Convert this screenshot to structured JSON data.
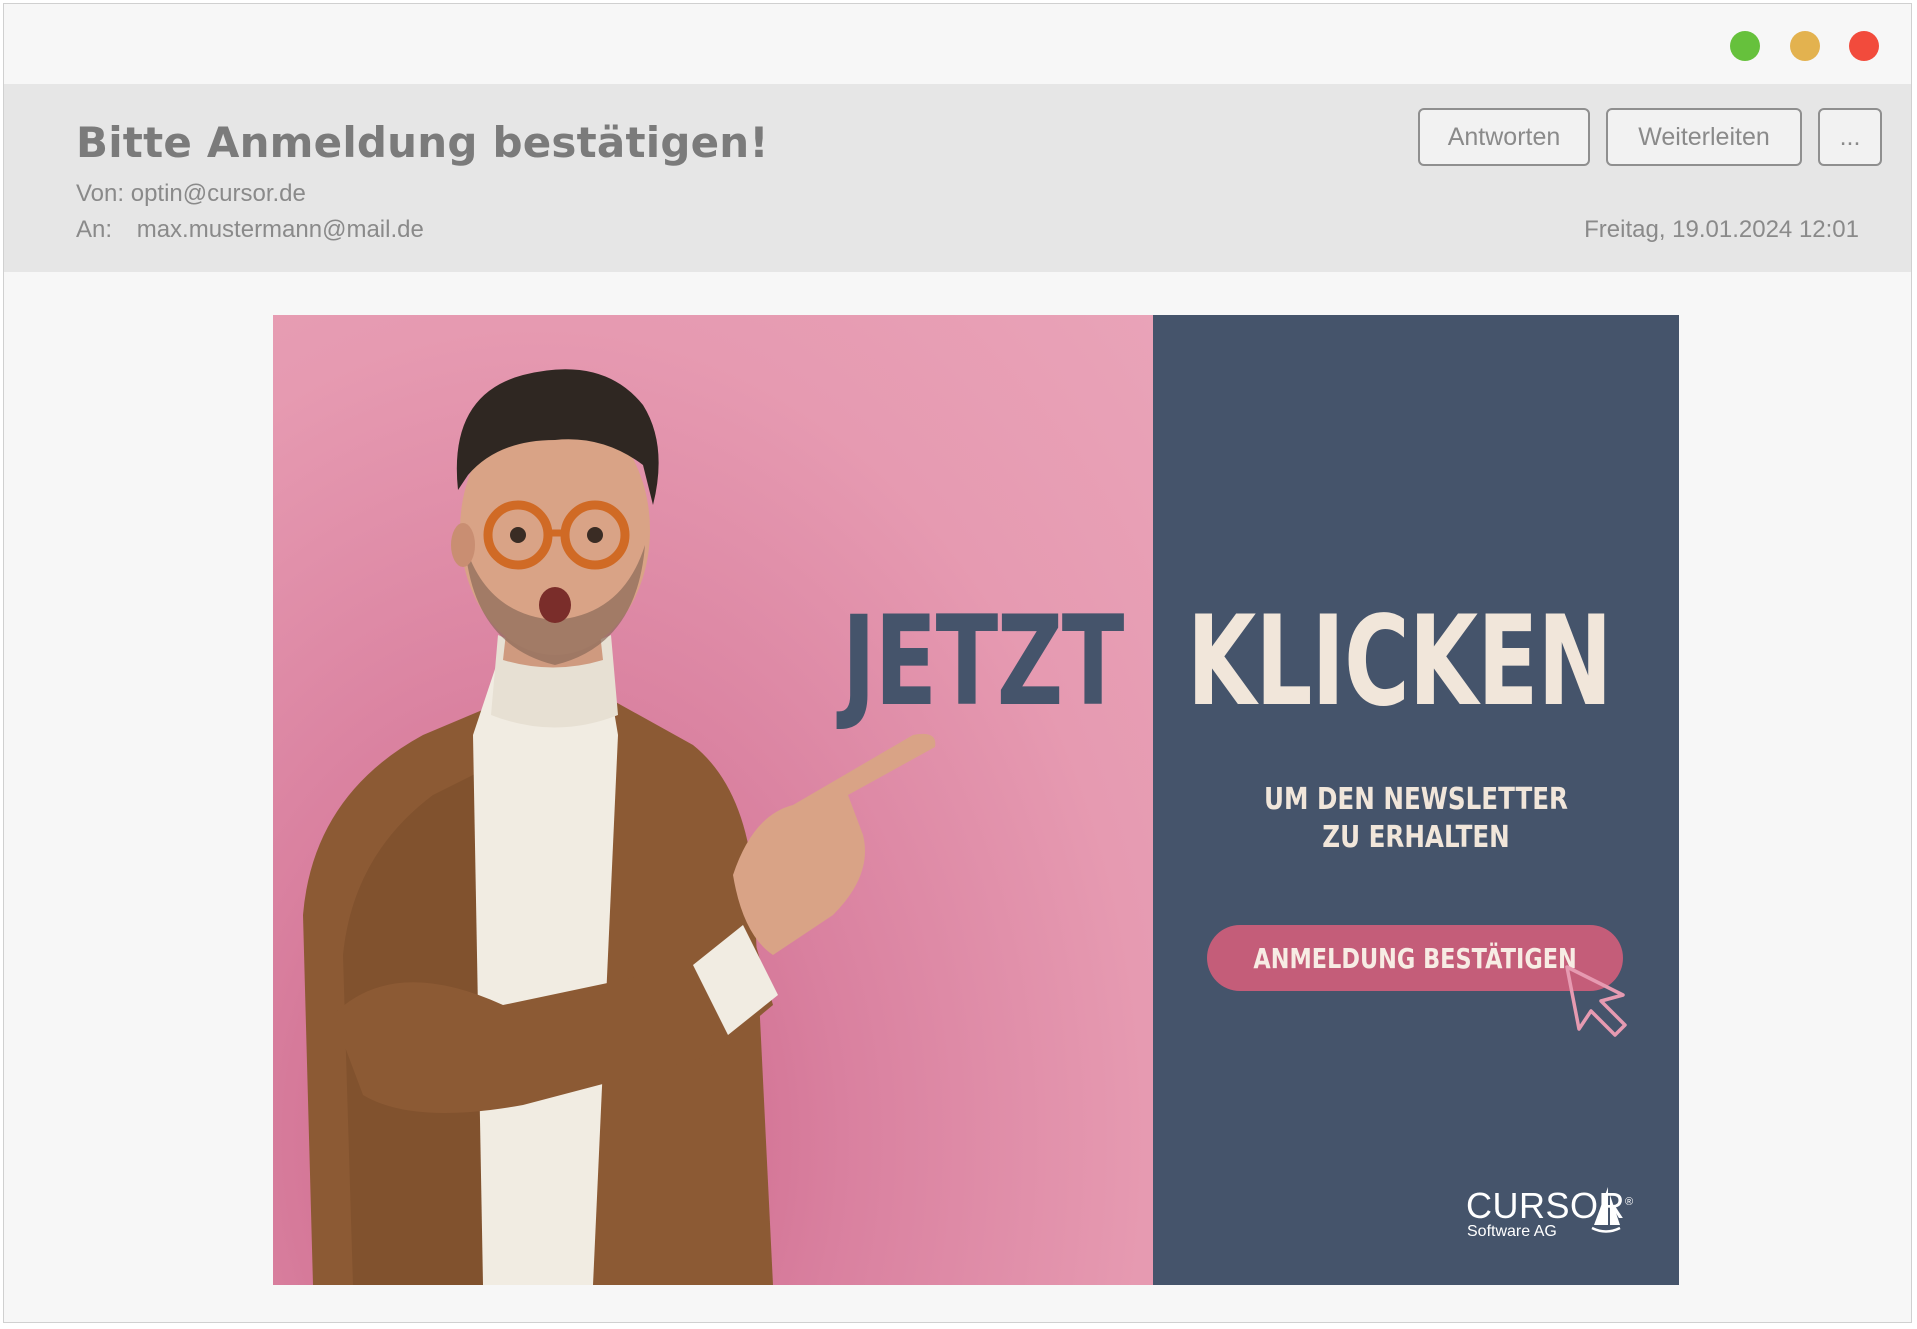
{
  "window": {
    "controls": [
      "green",
      "yellow",
      "red"
    ],
    "colors": {
      "green": "#66c13c",
      "yellow": "#e3b24f",
      "red": "#f24b3c"
    }
  },
  "email": {
    "subject": "Bitte Anmeldung bestätigen!",
    "from_label": "Von:",
    "from_address": "optin@cursor.de",
    "to_label": "An:",
    "to_address": "max.mustermann@mail.de",
    "date": "Freitag, 19.01.2024 12:01",
    "actions": {
      "reply": "Antworten",
      "forward": "Weiterleiten",
      "more": "..."
    }
  },
  "banner": {
    "headline_left": "JETZT",
    "headline_right": "KLICKEN",
    "subline_1": "UM DEN NEWSLETTER",
    "subline_2": "ZU ERHALTEN",
    "cta_label": "ANMELDUNG BESTÄTIGEN",
    "logo_main": "CURSOR",
    "logo_registered": "®",
    "logo_sub": "Software AG",
    "colors": {
      "pink": "#e69ab1",
      "navy": "#45546b",
      "cream": "#f1e6da",
      "cta": "#c45d79"
    }
  }
}
